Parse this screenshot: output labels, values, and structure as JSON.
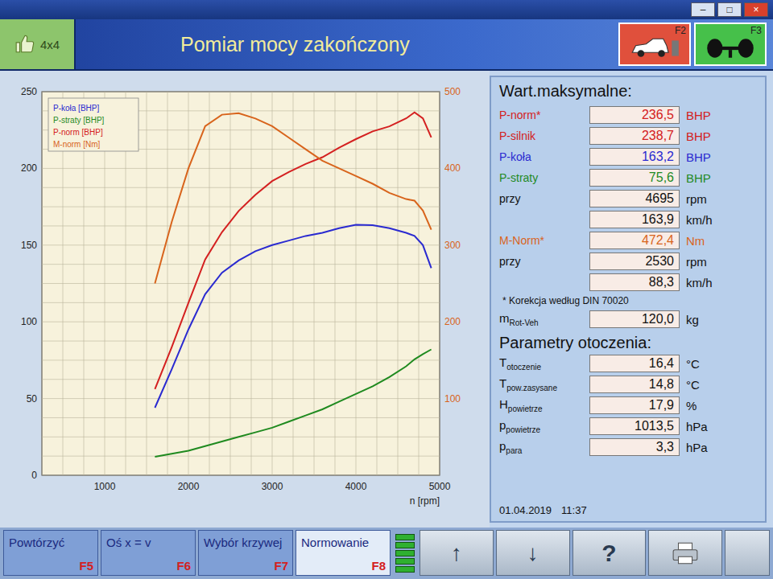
{
  "window": {
    "controls": [
      "–",
      "□",
      "×"
    ]
  },
  "header": {
    "mode": "4x4",
    "title": "Pomiar mocy zakończony",
    "buttons": [
      {
        "key": "F2",
        "kind": "car",
        "color": "#e0503c"
      },
      {
        "key": "F3",
        "kind": "axle",
        "color": "#46c04a"
      }
    ]
  },
  "chart": {
    "x_ticks": [
      "1000",
      "2000",
      "3000",
      "4000",
      "5000"
    ],
    "x_label": "n [rpm]",
    "left_ticks": [
      "0",
      "50",
      "100",
      "150",
      "200",
      "250"
    ],
    "right_ticks": [
      "100",
      "200",
      "300",
      "400",
      "500"
    ],
    "rpm": [
      1600,
      1800,
      2000,
      2200,
      2400,
      2600,
      2800,
      3000,
      3200,
      3400,
      3600,
      3800,
      4000,
      4200,
      4400,
      4600,
      4700,
      4800,
      4900
    ],
    "series": [
      {
        "name": "P-koła [BHP]",
        "axis": "left",
        "color": "#2a2ad0",
        "values": [
          44,
          69,
          95,
          118,
          132,
          140,
          146,
          150,
          153,
          156,
          158,
          161,
          163.2,
          163,
          161,
          158,
          156,
          150,
          135
        ]
      },
      {
        "name": "P-straty [BHP]",
        "axis": "left",
        "color": "#1f8a1f",
        "values": [
          12,
          14,
          16,
          19,
          22,
          25,
          28,
          31,
          35,
          39,
          43,
          48,
          53,
          58,
          64,
          71,
          75.6,
          79,
          82
        ]
      },
      {
        "name": "P-norm [BHP]",
        "axis": "left",
        "color": "#d42020",
        "values": [
          56.2,
          83.4,
          112.3,
          140.6,
          158.4,
          172.3,
          182.8,
          191.7,
          197.7,
          202.9,
          207.3,
          213.5,
          219.1,
          224.1,
          227.4,
          232.6,
          236.5,
          232.6,
          220.2
        ]
      },
      {
        "name": "M-norm [Nm]",
        "axis": "right",
        "color": "#d8641c",
        "values": [
          250,
          330,
          400,
          455,
          470,
          472,
          465,
          455,
          440,
          425,
          410,
          400,
          390,
          380,
          368,
          360,
          358,
          345,
          320
        ]
      }
    ]
  },
  "maxima": {
    "title": "Wart.maksymalne:",
    "rows": [
      {
        "label": "P-norm*",
        "value": "236,5",
        "unit": "BHP",
        "color": "#d42020"
      },
      {
        "label": "P-silnik",
        "value": "238,7",
        "unit": "BHP",
        "color": "#d42020"
      },
      {
        "label": "P-koła",
        "value": "163,2",
        "unit": "BHP",
        "color": "#2a2ad0"
      },
      {
        "label": "P-straty",
        "value": "75,6",
        "unit": "BHP",
        "color": "#1f8a1f"
      },
      {
        "label": "przy",
        "value": "4695",
        "unit": "rpm",
        "color": "#111111"
      },
      {
        "label": "",
        "value": "163,9",
        "unit": "km/h",
        "color": "#111111"
      },
      {
        "label": "M-Norm*",
        "value": "472,4",
        "unit": "Nm",
        "color": "#d8641c"
      },
      {
        "label": "przy",
        "value": "2530",
        "unit": "rpm",
        "color": "#111111"
      },
      {
        "label": "",
        "value": "88,3",
        "unit": "km/h",
        "color": "#111111"
      }
    ],
    "note": "* Korekcja według DIN 70020",
    "mass": {
      "symbol": "m",
      "sub": "Rot-Veh",
      "value": "120,0",
      "unit": "kg"
    }
  },
  "ambient": {
    "title": "Parametry otoczenia:",
    "rows": [
      {
        "symbol": "T",
        "sub": "otoczenie",
        "value": "16,4",
        "unit": "°C"
      },
      {
        "symbol": "T",
        "sub": "pow.zasysane",
        "value": "14,8",
        "unit": "°C"
      },
      {
        "symbol": "H",
        "sub": "powietrze",
        "value": "17,9",
        "unit": "%"
      },
      {
        "symbol": "p",
        "sub": "powietrze",
        "value": "1013,5",
        "unit": "hPa"
      },
      {
        "symbol": "p",
        "sub": "para",
        "value": "3,3",
        "unit": "hPa"
      }
    ]
  },
  "timestamp": {
    "date": "01.04.2019",
    "time": "11:37"
  },
  "footer": {
    "buttons": [
      {
        "label": "Powtórzyć",
        "key": "F5",
        "selected": false
      },
      {
        "label": "Oś x = v",
        "key": "F6",
        "selected": false
      },
      {
        "label": "Wybór krzywej",
        "key": "F7",
        "selected": false
      },
      {
        "label": "Normowanie",
        "key": "F8",
        "selected": true
      }
    ],
    "tools": [
      {
        "kind": "indicator",
        "label": ""
      },
      {
        "kind": "arrow",
        "label": "↑"
      },
      {
        "kind": "arrow",
        "label": "↓"
      },
      {
        "kind": "help",
        "label": "?"
      },
      {
        "kind": "print",
        "label": ""
      },
      {
        "kind": "blank",
        "label": ""
      }
    ]
  }
}
